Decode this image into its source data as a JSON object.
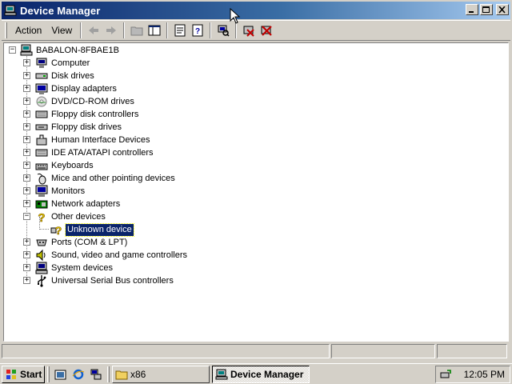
{
  "window": {
    "title": "Device Manager",
    "menu": [
      {
        "label": "Action"
      },
      {
        "label": "View"
      }
    ]
  },
  "tree": {
    "root": {
      "label": "BABALON-8FBAE1B",
      "icon": "computer-icon"
    },
    "categories": [
      {
        "label": "Computer",
        "icon": "computer-icon",
        "expanded": false
      },
      {
        "label": "Disk drives",
        "icon": "disk-drive-icon",
        "expanded": false
      },
      {
        "label": "Display adapters",
        "icon": "display-adapter-icon",
        "expanded": false
      },
      {
        "label": "DVD/CD-ROM drives",
        "icon": "cdrom-icon",
        "expanded": false
      },
      {
        "label": "Floppy disk controllers",
        "icon": "controller-icon",
        "expanded": false
      },
      {
        "label": "Floppy disk drives",
        "icon": "floppy-drive-icon",
        "expanded": false
      },
      {
        "label": "Human Interface Devices",
        "icon": "hid-icon",
        "expanded": false
      },
      {
        "label": "IDE ATA/ATAPI controllers",
        "icon": "controller-icon",
        "expanded": false
      },
      {
        "label": "Keyboards",
        "icon": "keyboard-icon",
        "expanded": false
      },
      {
        "label": "Mice and other pointing devices",
        "icon": "mouse-icon",
        "expanded": false
      },
      {
        "label": "Monitors",
        "icon": "monitor-icon",
        "expanded": false
      },
      {
        "label": "Network adapters",
        "icon": "network-adapter-icon",
        "expanded": false
      },
      {
        "label": "Other devices",
        "icon": "question-icon",
        "expanded": true,
        "children": [
          {
            "label": "Unknown device",
            "icon": "unknown-device-icon",
            "selected": true
          }
        ]
      },
      {
        "label": "Ports (COM & LPT)",
        "icon": "port-icon",
        "expanded": false
      },
      {
        "label": "Sound, video and game controllers",
        "icon": "speaker-icon",
        "expanded": false
      },
      {
        "label": "System devices",
        "icon": "system-device-icon",
        "expanded": false
      },
      {
        "label": "Universal Serial Bus controllers",
        "icon": "usb-icon",
        "expanded": false
      }
    ]
  },
  "taskbar": {
    "start_label": "Start",
    "tasks": [
      {
        "label": "x86",
        "icon": "folder-icon",
        "active": false
      },
      {
        "label": "Device Manager",
        "icon": "device-manager-icon",
        "active": true
      }
    ],
    "clock": "12:05 PM"
  },
  "colors": {
    "title_start": "#0a246a",
    "title_end": "#a6caf0",
    "selection": "#0a246a",
    "face": "#d4d0c8"
  }
}
